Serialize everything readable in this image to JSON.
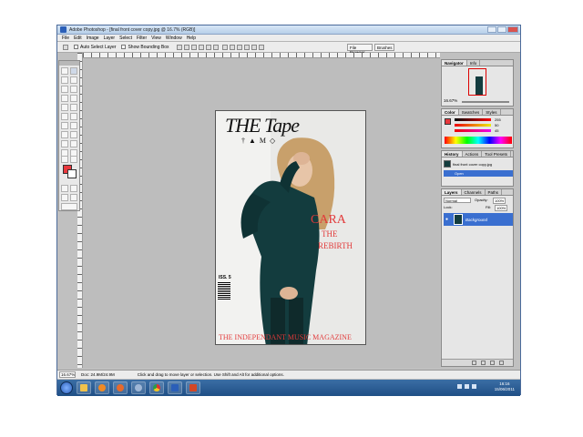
{
  "window": {
    "title": "Adobe Photoshop - [final front cover copy.jpg @ 16.7% (RGB)]"
  },
  "menu": [
    "File",
    "Edit",
    "Image",
    "Layer",
    "Select",
    "Filter",
    "View",
    "Window",
    "Help"
  ],
  "options_bar": {
    "auto_select_layer": "Auto Select Layer",
    "show_bounding_box": "Show Bounding Box",
    "file_browser": "File Browser",
    "brushes": "Brushes"
  },
  "document": {
    "title": "THE Tape",
    "subtitle": "† ▲ M ◇",
    "headline": "CARA",
    "line2": "THE",
    "line3": "REBIRTH",
    "issue": "ISS. 5",
    "footer": "THE INDEPENDANT MUSIC MAGAZINE"
  },
  "navigator": {
    "tabs": [
      "Navigator",
      "Info"
    ],
    "zoom": "16.67%"
  },
  "color_panel": {
    "tabs": [
      "Color",
      "Swatches",
      "Styles"
    ],
    "r": "255",
    "g": "50",
    "b": "45",
    "fg_color": "#e8383d"
  },
  "history_panel": {
    "tabs": [
      "History",
      "Actions",
      "Tool Presets"
    ],
    "items": [
      "final front cover copy.jpg",
      "Open"
    ]
  },
  "layers_panel": {
    "tabs": [
      "Layers",
      "Channels",
      "Paths"
    ],
    "blend_mode": "Normal",
    "opacity_label": "Opacity:",
    "opacity": "100%",
    "lock_label": "Lock:",
    "fill_label": "Fill:",
    "fill": "100%",
    "layers": [
      "Background"
    ]
  },
  "status_bar": {
    "zoom": "16.67%",
    "doc_info": "Doc: 24.9M/24.9M",
    "hint": "Click and drag to move layer or selection. Use Shift and Alt for additional options."
  },
  "taskbar": {
    "time": "16:16",
    "date": "15/06/2011"
  }
}
